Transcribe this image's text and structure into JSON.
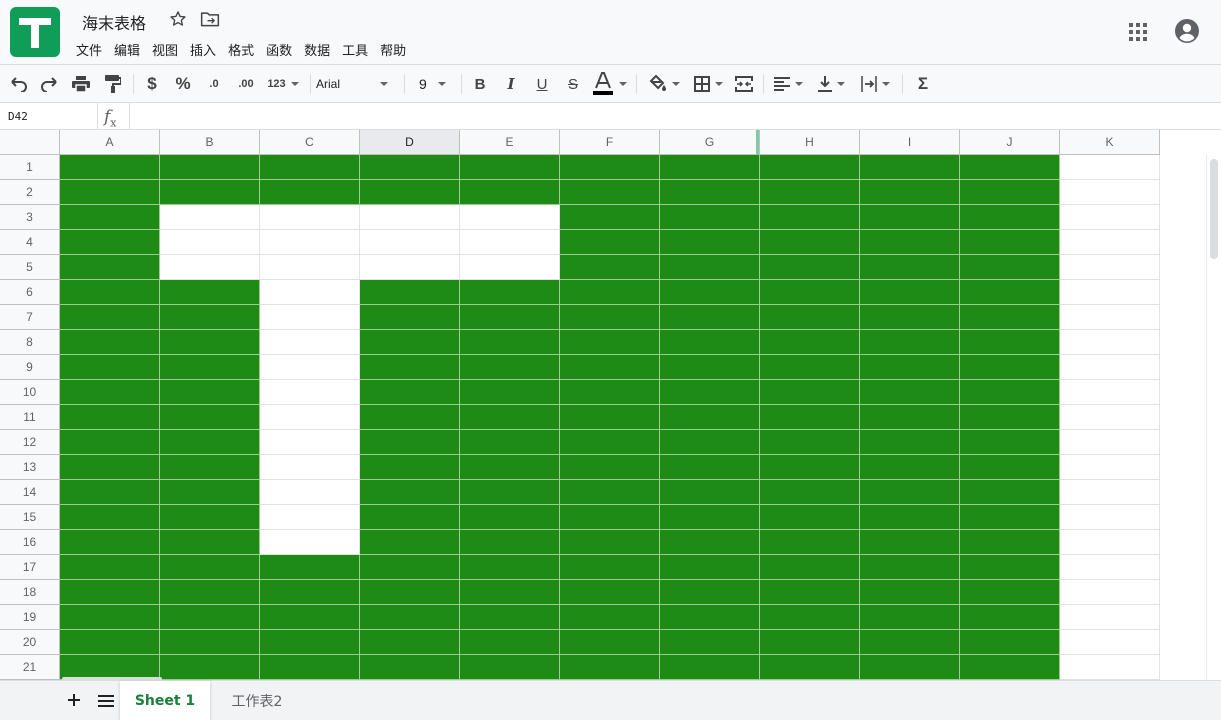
{
  "app": {
    "title": "海末表格",
    "menu": [
      "文件",
      "编辑",
      "视图",
      "插入",
      "格式",
      "函数",
      "数据",
      "工具",
      "帮助"
    ]
  },
  "toolbar": {
    "font": "Arial",
    "font_size": "9",
    "number_format_label": "123",
    "decimal_decrease_label": ".0",
    "decimal_increase_label": ".00"
  },
  "formula_bar": {
    "cell_ref": "D42",
    "fx_label": "f",
    "fx_sub": "x",
    "value": ""
  },
  "grid": {
    "columns": [
      "A",
      "B",
      "C",
      "D",
      "E",
      "F",
      "G",
      "H",
      "I",
      "J",
      "K"
    ],
    "active_column": "D",
    "rows": [
      "1",
      "2",
      "3",
      "4",
      "5",
      "6",
      "7",
      "8",
      "9",
      "10",
      "11",
      "12",
      "13",
      "14",
      "15",
      "16",
      "17",
      "18",
      "19",
      "20",
      "21"
    ],
    "fill_color": "#1e8b14",
    "filled_range": "A1:J21",
    "white_cells": [
      "B3",
      "C3",
      "D3",
      "E3",
      "B4",
      "C4",
      "D4",
      "E4",
      "B5",
      "C5",
      "D5",
      "E5",
      "C6",
      "C7",
      "C8",
      "C9",
      "C10",
      "C11",
      "C12",
      "C13",
      "C14",
      "C15",
      "C16"
    ]
  },
  "sheets": {
    "tabs": [
      "Sheet 1",
      "工作表2"
    ],
    "active": "Sheet 1"
  },
  "colors": {
    "brand": "#0f9d58",
    "active_tab_text": "#188038",
    "cell_fill": "#1e8b14"
  }
}
